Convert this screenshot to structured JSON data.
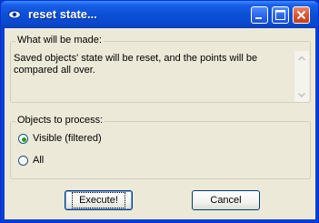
{
  "window": {
    "title": "reset state...",
    "icon": "eye-icon"
  },
  "description_group": {
    "legend": "What will be made:",
    "text": "Saved objects' state will be reset, and the points will be compared all over."
  },
  "objects_group": {
    "legend": "Objects to process:",
    "options": [
      {
        "label": "Visible (filtered)",
        "selected": true
      },
      {
        "label": "All",
        "selected": false
      }
    ]
  },
  "buttons": {
    "execute": "Execute!",
    "cancel": "Cancel"
  },
  "colors": {
    "titlebar": "#0b4fd6",
    "client": "#ece9d8",
    "radio_dot": "#21a121"
  }
}
